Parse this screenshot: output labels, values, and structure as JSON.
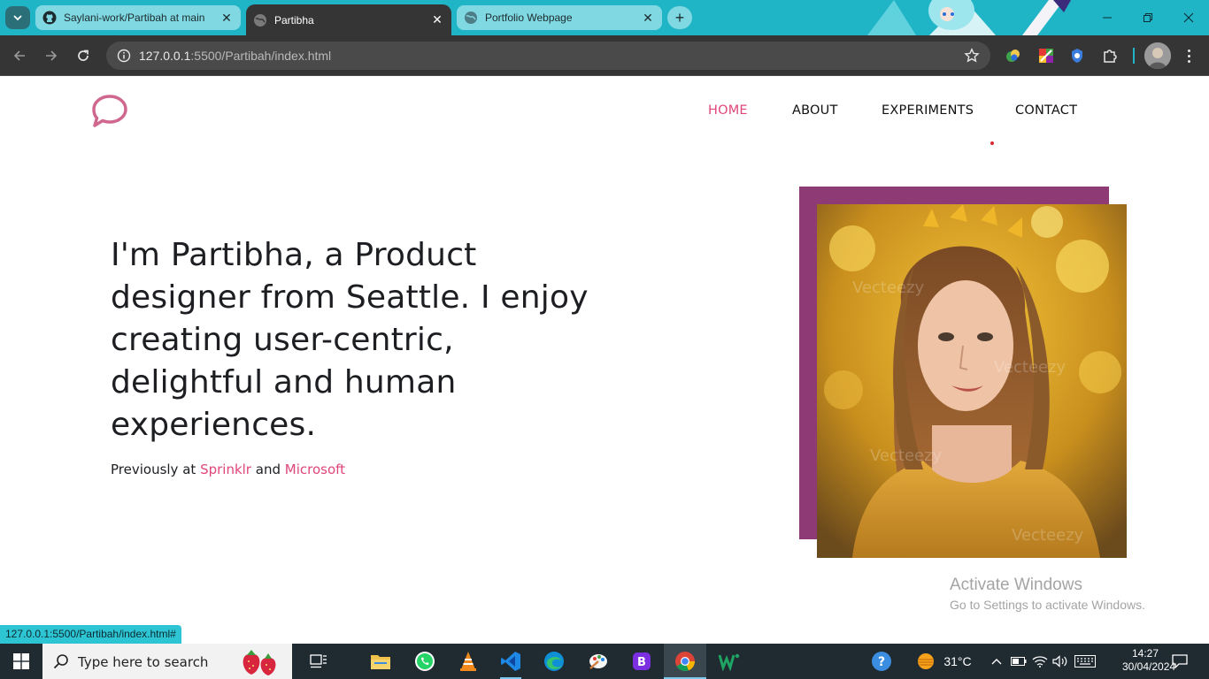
{
  "browser": {
    "tabs": [
      {
        "label": "Saylani-work/Partibah at main",
        "favicon": "github-icon",
        "active": false
      },
      {
        "label": "Partibha",
        "favicon": "globe-icon",
        "active": true
      },
      {
        "label": "Portfolio Webpage",
        "favicon": "globe-icon",
        "active": false
      }
    ],
    "address": {
      "host": "127.0.0.1",
      "path": ":5500/Partibah/index.html"
    },
    "status_url": "127.0.0.1:5500/Partibah/index.html#"
  },
  "site": {
    "nav": [
      {
        "label": "HOME",
        "active": true
      },
      {
        "label": "ABOUT",
        "active": false
      },
      {
        "label": "EXPERIMENTS",
        "active": false
      },
      {
        "label": "CONTACT",
        "active": false
      }
    ],
    "hero": {
      "headline": "I'm Partibha, a Product designer from Seattle. I enjoy creating user-centric, delightful and human experiences.",
      "previously_prefix": "Previously at",
      "company_1": "Sprinklr",
      "conjunction": "and",
      "company_2": "Microsoft"
    },
    "photo": {
      "watermark": "Vecteezy"
    },
    "colors": {
      "accent": "#e0457b",
      "frame": "#8e3a74",
      "heading": "#1c1e21"
    }
  },
  "watermark": {
    "line1": "Activate Windows",
    "line2": "Go to Settings to activate Windows."
  },
  "taskbar": {
    "search_placeholder": "Type here to search",
    "weather": "31°C",
    "time": "14:27",
    "date": "30/04/2024"
  }
}
